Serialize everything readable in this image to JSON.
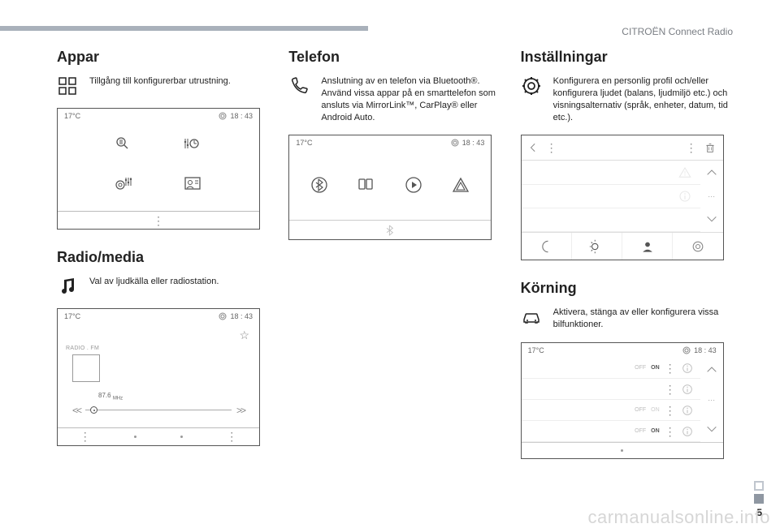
{
  "header": {
    "product": "CITROËN Connect Radio"
  },
  "page_number": "5",
  "watermark": "carmanualsonline.info",
  "status_bar": {
    "temp": "17°C",
    "time": "18 : 43"
  },
  "apps": {
    "title": "Appar",
    "desc": "Tillgång till konfigurerbar utrustning."
  },
  "radio": {
    "title": "Radio/media",
    "desc": "Val av ljudkälla eller radiostation.",
    "source_label": "RADIO . FM",
    "frequency_value": "87.6",
    "frequency_unit": "MHz"
  },
  "phone": {
    "title": "Telefon",
    "desc": "Anslutning av en telefon via Bluetooth®.\nAnvänd vissa appar på en smarttelefon som ansluts via MirrorLink™, CarPlay® eller Android Auto."
  },
  "settings": {
    "title": "Inställningar",
    "desc": "Konfigurera en personlig profil och/eller konfigurera ljudet (balans, ljudmiljö etc.) och visningsalternativ (språk, enheter, datum, tid etc.)."
  },
  "driving": {
    "title": "Körning",
    "desc": "Aktivera, stänga av eller konfigurera vissa bilfunktioner.",
    "toggle_off": "OFF",
    "toggle_on": "ON"
  }
}
